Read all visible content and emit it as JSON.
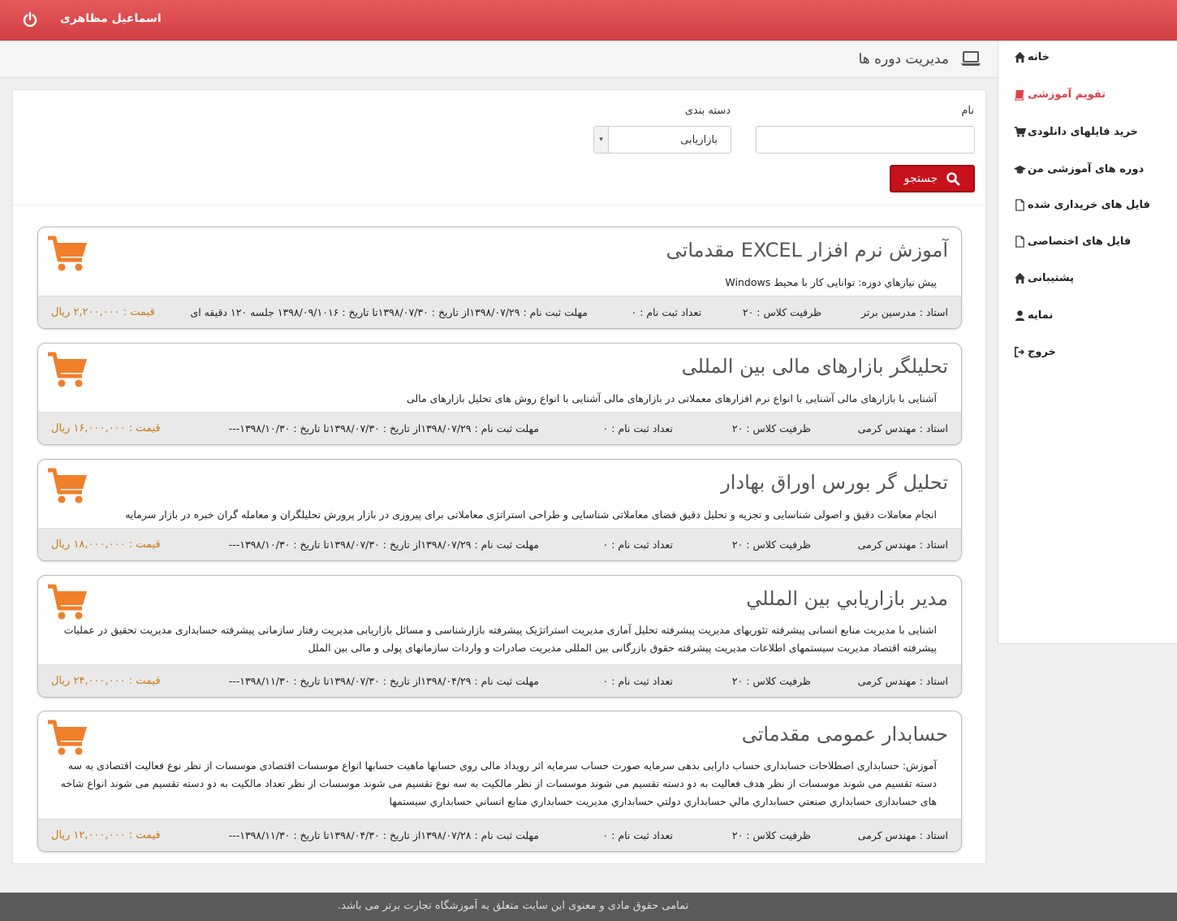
{
  "header": {
    "user_name": "اسماعیل مظاهری"
  },
  "page": {
    "title": "مدیریت دوره ها"
  },
  "sidebar": {
    "items": [
      {
        "label": "خانه",
        "icon": "home-icon"
      },
      {
        "label": "تقویم آموزشی",
        "icon": "book-icon",
        "active": true
      },
      {
        "label": "خرید فایلهای دانلودی",
        "icon": "cart-icon"
      },
      {
        "label": "دوره های آموزشی من",
        "icon": "graduation-cap-icon"
      },
      {
        "label": "فایل های خریداری شده",
        "icon": "file-icon"
      },
      {
        "label": "فایل های اختصاصی",
        "icon": "file-icon"
      },
      {
        "label": "پشتیبانی",
        "icon": "home-icon"
      },
      {
        "label": "نمایه",
        "icon": "user-icon"
      },
      {
        "label": "خروج",
        "icon": "sign-out-icon"
      }
    ]
  },
  "filters": {
    "name_label": "نام",
    "name_value": "",
    "category_label": "دسته بندی",
    "category_value": "بازاریابی",
    "search_label": "جستجو"
  },
  "courses": [
    {
      "title": "آموزش نرم افزار EXCEL مقدماتی",
      "description": "پیش نیازهاي دوره: توانایی کار با محیط Windows",
      "teacher": "استاد : مدرسین برتر",
      "capacity": "ظرفیت کلاس : ۲۰",
      "registered": "تعداد ثبت نام : ۰",
      "registration": "مهلت ثبت نام : ۱۳۹۸/۰۷/۲۹از تاریخ : ۱۳۹۸/۰۷/۳۰تا تاریخ : ۱۳۹۸/۰۹/۱۰۱۶ جلسه ۱۲۰ دقیقه ای",
      "price": "قیمت : ۲,۲۰۰,۰۰۰ ریال"
    },
    {
      "title": "تحلیلگر بازارهای مالی بین المللی",
      "description": "آشنایی با بازارهای مالی آشنایی با انواع نرم افزارهای معملاتی در بازارهای مالی آشنایی با انواع روش های تحلیل بازارهای مالی",
      "teacher": "استاد : مهندس کرمی",
      "capacity": "ظرفیت کلاس : ۲۰",
      "registered": "تعداد ثبت نام : ۰",
      "registration": "مهلت ثبت نام : ۱۳۹۸/۰۷/۲۹از تاریخ : ۱۳۹۸/۰۷/۳۰تا تاریخ : ۱۳۹۸/۱۰/۳۰---",
      "price": "قیمت : ۱۶,۰۰۰,۰۰۰ ریال"
    },
    {
      "title": "تحلیل گر بورس اوراق بهادار",
      "description": "انجام معاملات دقیق و اصولی شناسایی و تجزیه و تحلیل دقیق فضای معاملاتی شناسایی و طراحی استراتژی معاملاتی برای پیروزی در بازار پرورش تحلیلگران و معامله گران خبره در بازار سرمایه",
      "teacher": "استاد : مهندس کرمی",
      "capacity": "ظرفیت کلاس : ۲۰",
      "registered": "تعداد ثبت نام : ۰",
      "registration": "مهلت ثبت نام : ۱۳۹۸/۰۷/۲۹از تاریخ : ۱۳۹۸/۰۷/۳۰تا تاریخ : ۱۳۹۸/۱۰/۳۰---",
      "price": "قیمت : ۱۸,۰۰۰,۰۰۰ ریال"
    },
    {
      "title": "مدیر بازاریابي بین المللي",
      "description": "اشنایی با مدیریت منابع انسانی پیشرفته تئوریهای مدیریت پیشرفته تحلیل آماری مدیریت استراتژیک پیشرفته بازارشناسی و مسائل بازاریابی مدیریت رفتار سازمانی پیشرفته حسابداری مدیریت تحقیق در عملیات پیشرفته اقتصاد مدیریت سیستمهای اطلاعات مدیریت پیشرفته حقوق بازرگانی بین المللی مدیریت صادرات و واردات سازمانهای پولی و مالی بین الملل",
      "teacher": "استاد : مهندس کرمی",
      "capacity": "ظرفیت کلاس : ۲۰",
      "registered": "تعداد ثبت نام : ۰",
      "registration": "مهلت ثبت نام : ۱۳۹۸/۰۴/۲۹از تاریخ : ۱۳۹۸/۰۷/۳۰تا تاریخ : ۱۳۹۸/۱۱/۳۰---",
      "price": "قیمت : ۲۴,۰۰۰,۰۰۰ ریال"
    },
    {
      "title": "حسابدار عمومی مقدماتی",
      "description": "آموزش: حسابداری اصطلاحات حسابداری حساب دارایی بدهی سرمایه صورت حساب سرمایه اثر رویداد مالی روی حسابها ماهیت حسابها انواع موسسات اقتصادی موسسات از نظر نوع فعالیت اقتصادی به سه دسته تقسیم می شوند موسسات از نظر هدف فعالیت به دو دسته تقسیم می شوند موسسات از نظر مالکیت به سه نوع تقسیم می شوند موسسات از نظر تعداد مالکیت به دو دسته تقسیم می شوند انواع شاخه های حسابداری حسابداري صنعتي حسابداري مالي حسابداري دولتي حسابداري مديريت حسابداري منابع انساني حسابداري سيستمها",
      "teacher": "استاد : مهندس کرمی",
      "capacity": "ظرفیت کلاس : ۲۰",
      "registered": "تعداد ثبت نام : ۰",
      "registration": "مهلت ثبت نام : ۱۳۹۸/۰۷/۲۸از تاریخ : ۱۳۹۸/۰۴/۳۰تا تاریخ : ۱۳۹۸/۱۱/۳۰---",
      "price": "قیمت : ۱۲,۰۰۰,۰۰۰ ریال"
    }
  ],
  "footer": {
    "text": "تمامی حقوق مادی و معنوی این سایت متعلق به آموزشگاه تجارت برتر می باشد."
  },
  "colors": {
    "header": "#d9434b",
    "accent_orange": "#f07f2a",
    "price": "#c87b1a",
    "search_button": "#c7111b"
  }
}
